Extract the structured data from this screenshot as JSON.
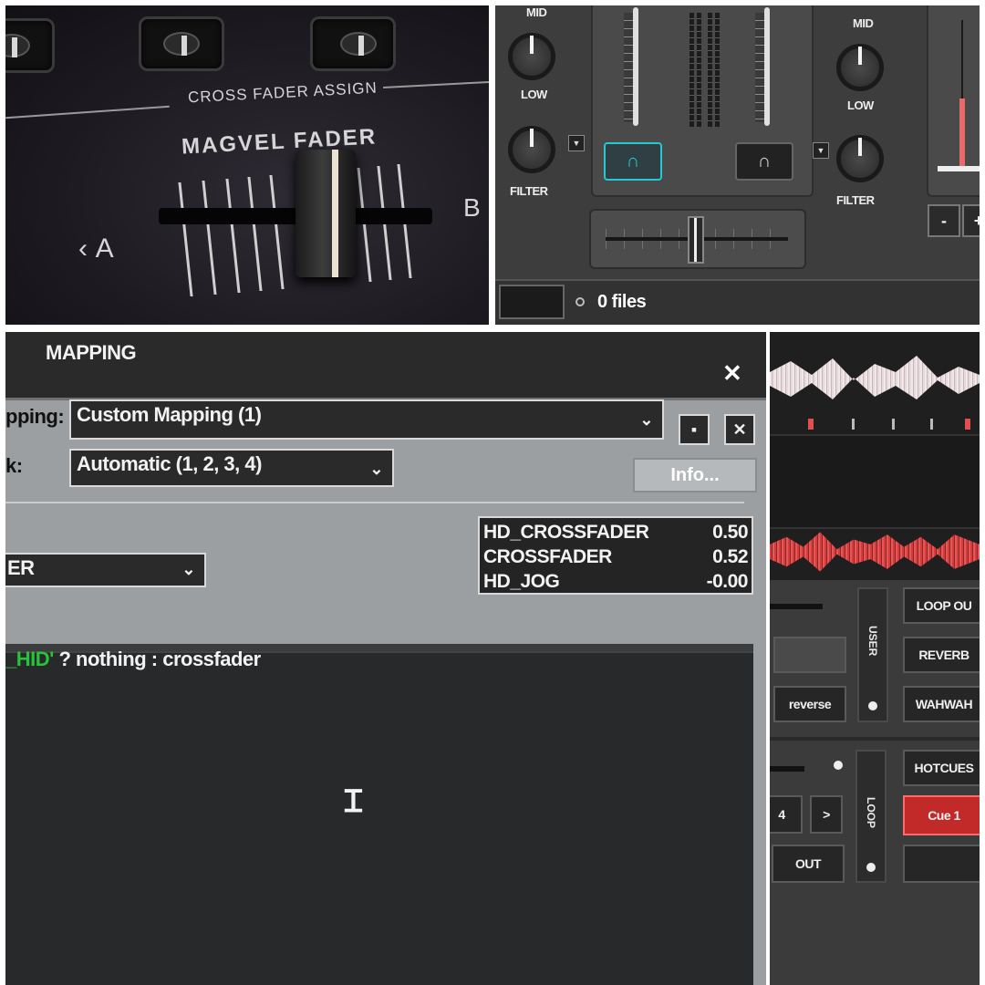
{
  "hardware": {
    "section_label": "CROSS FADER ASSIGN",
    "brand": "MAGVEL FADER",
    "side_a": "A",
    "side_b": "B"
  },
  "software_mixer": {
    "left_deck": {
      "eq_mid": "MID",
      "eq_low": "LOW",
      "filter": "FILTER"
    },
    "right_deck": {
      "eq_mid": "MID",
      "eq_low": "LOW",
      "filter": "FILTER"
    },
    "headphone_left_active": true,
    "headphone_right_active": false,
    "minus_label": "-",
    "plus_label": "+",
    "files_status": "0 files",
    "accent_color": "#27c8cf",
    "volume_color": "#e86a6a"
  },
  "mapping_dialog": {
    "title": "MAPPING",
    "close_glyph": "✕",
    "mapping_label": "pping:",
    "mapping_value": "Custom Mapping (1)",
    "deck_label": "k:",
    "deck_value": "Automatic (1, 2, 3, 4)",
    "info_button": "Info...",
    "action_value": "ER",
    "live_values": [
      {
        "name": "HD_CROSSFADER",
        "value": "0.50"
      },
      {
        "name": "CROSSFADER",
        "value": "0.52"
      },
      {
        "name": "HD_JOG",
        "value": "-0.00"
      }
    ],
    "script_green": "_HID'",
    "script_rest": " ? nothing : crossfader"
  },
  "deck_controls": {
    "loop_out": "LOOP OU",
    "reverb": "REVERB",
    "wahwah": "WAHWAH",
    "reverse": "reverse",
    "user_label": "USER",
    "hotcues": "HOTCUES",
    "loop_label": "LOOP",
    "cue_1": "Cue 1",
    "loop_size": "4",
    "next_glyph": ">",
    "out_label": "OUT",
    "cue_color": "#c22a2a",
    "waveform_color": "#d63c3c"
  }
}
